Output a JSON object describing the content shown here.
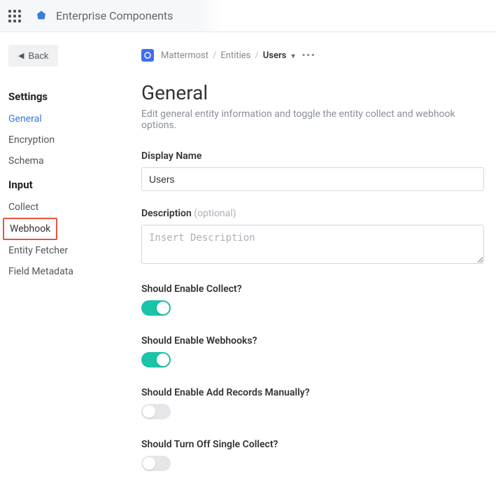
{
  "header": {
    "app_title": "Enterprise Components"
  },
  "back": {
    "label": "Back"
  },
  "nav": {
    "settings_heading": "Settings",
    "input_heading": "Input",
    "settings": [
      {
        "label": "General"
      },
      {
        "label": "Encryption"
      },
      {
        "label": "Schema"
      }
    ],
    "input": [
      {
        "label": "Collect"
      },
      {
        "label": "Webhook"
      },
      {
        "label": "Entity Fetcher"
      },
      {
        "label": "Field Metadata"
      }
    ]
  },
  "breadcrumb": {
    "root": "Mattermost",
    "mid": "Entities",
    "current": "Users"
  },
  "page": {
    "title": "General",
    "description": "Edit general entity information and toggle the entity collect and webhook options."
  },
  "fields": {
    "display_name_label": "Display Name",
    "display_name_value": "Users",
    "description_label": "Description",
    "description_optional": "(optional)",
    "description_placeholder": "Insert Description",
    "description_value": ""
  },
  "toggles": {
    "collect_label": "Should Enable Collect?",
    "collect_on": true,
    "webhooks_label": "Should Enable Webhooks?",
    "webhooks_on": true,
    "add_records_label": "Should Enable Add Records Manually?",
    "add_records_on": false,
    "single_collect_label": "Should Turn Off Single Collect?",
    "single_collect_on": false
  }
}
